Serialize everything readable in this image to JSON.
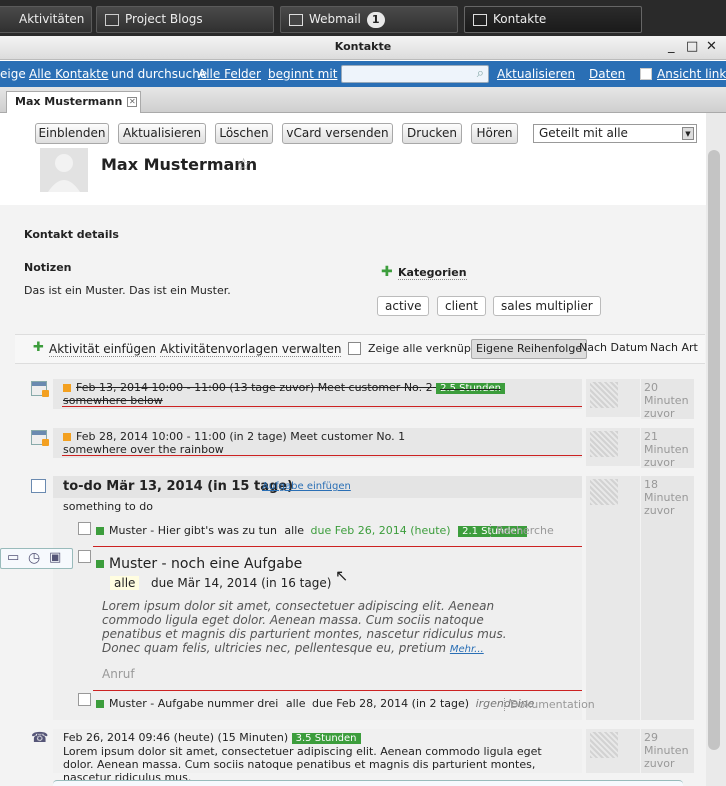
{
  "taskbar": {
    "tabs": [
      {
        "label": "Aktivitäten",
        "icon": "activity-icon"
      },
      {
        "label": "Project Blogs",
        "icon": "blog-icon"
      },
      {
        "label": "Webmail",
        "icon": "mail-icon",
        "badge": "1"
      },
      {
        "label": "Kontakte",
        "icon": "contacts-icon"
      }
    ]
  },
  "window": {
    "title": "Kontakte"
  },
  "searchbar": {
    "prefix": "eige",
    "all_contacts": "Alle Kontakte",
    "search_in": "und durchsuche",
    "all_fields": "Alle Felder",
    "starts_with": "beginnt mit",
    "search_value": "",
    "refresh": "Aktualisieren",
    "data": "Daten",
    "view_link": "Ansicht link"
  },
  "contact_tab": {
    "label": "Max Mustermann"
  },
  "toolbar": {
    "show": "Einblenden",
    "refresh": "Aktualisieren",
    "delete": "Löschen",
    "vcard": "vCard versenden",
    "print": "Drucken",
    "listen": "Hören",
    "share_select": "Geteilt mit alle"
  },
  "contact": {
    "name": "Max Mustermann"
  },
  "details": {
    "heading": "Kontakt details",
    "notes_label": "Notizen",
    "notes_text": "Das ist ein Muster. Das ist ein Muster.",
    "categories_label": "Kategorien",
    "tags": [
      "active",
      "client",
      "sales multiplier"
    ]
  },
  "activity_bar": {
    "add": "Aktivität einfügen",
    "templates": "Aktivitätenvorlagen verwalten",
    "show_linked": "Zeige alle verknüpfte",
    "own_order": "Eigene Reihenfolge",
    "by_date": "Nach Datum",
    "by_type": "Nach Art"
  },
  "activities": [
    {
      "line": "Feb 13, 2014 10:00 - 11:00 (13 tage zuvor) Meet customer No. 2",
      "badge": "2.5 Stunden",
      "sub": "somewhere below",
      "time": [
        "20",
        "Minuten",
        "zuvor"
      ]
    },
    {
      "line": "Feb 28, 2014 10:00 - 11:00 (in 2 tage) Meet customer No. 1",
      "sub": "somewhere over the rainbow",
      "time": [
        "21",
        "Minuten",
        "zuvor"
      ]
    }
  ],
  "todo": {
    "title": "to-do Mär 13, 2014 (in 15 tage)",
    "add_task": "Aufgabe einfügen",
    "desc": "something to do",
    "time": [
      "18",
      "Minuten",
      "zuvor"
    ],
    "task1": {
      "title": "Muster - Hier gibt's was zu tun",
      "who": "alle",
      "due": "due Feb 26, 2014 (heute)",
      "badge": "2.1 Stunden",
      "tag": "Recherche"
    },
    "task2": {
      "title": "Muster - noch eine Aufgabe",
      "who": "alle",
      "due": "due Mär 14, 2014 (in 16 tage)",
      "lorem": "Lorem ipsum dolor sit amet, consectetuer adipiscing elit. Aenean commodo ligula eget dolor. Aenean massa. Cum sociis natoque penatibus et magnis dis parturient montes, nascetur ridiculus mus. Donec quam felis, ultricies nec, pellentesque eu, pretium",
      "more": "Mehr...",
      "call": "Anruf"
    },
    "task3": {
      "title": "Muster - Aufgabe nummer drei",
      "who": "alle",
      "due": "due Feb 28, 2014 (in 2 tage)",
      "assignee": "irgendeine",
      "tag": "Dokumentation"
    }
  },
  "call": {
    "line": "Feb 26, 2014 09:46 (heute) (15 Minuten)",
    "badge": "3.5 Stunden",
    "text": "Lorem ipsum dolor sit amet, consectetuer adipiscing elit. Aenean commodo ligula eget dolor. Aenean massa. Cum sociis natoque penatibus et magnis dis parturient montes, nascetur ridiculus mus.",
    "time": [
      "29",
      "Minuten",
      "zuvor"
    ]
  },
  "colors": {
    "accent": "#2a6fb5",
    "green": "#3c9d3c",
    "orange": "#f3a020",
    "red": "#cc2222"
  }
}
